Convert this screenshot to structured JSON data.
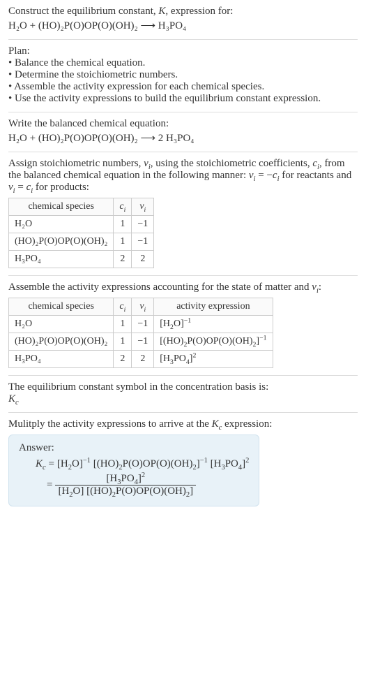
{
  "intro": {
    "heading": "Construct the equilibrium constant, K, expression for:",
    "reaction": "H₂O + (HO)₂P(O)OP(O)(OH)₂  ⟶  H₃PO₄"
  },
  "plan": {
    "title": "Plan:",
    "items": [
      "• Balance the chemical equation.",
      "• Determine the stoichiometric numbers.",
      "• Assemble the activity expression for each chemical species.",
      "• Use the activity expressions to build the equilibrium constant expression."
    ]
  },
  "balanced": {
    "heading": "Write the balanced chemical equation:",
    "reaction": "H₂O + (HO)₂P(O)OP(O)(OH)₂  ⟶  2 H₃PO₄"
  },
  "stoich": {
    "heading": "Assign stoichiometric numbers, νᵢ, using the stoichiometric coefficients, cᵢ, from the balanced chemical equation in the following manner: νᵢ = −cᵢ for reactants and νᵢ = cᵢ for products:",
    "headers": [
      "chemical species",
      "cᵢ",
      "νᵢ"
    ],
    "rows": [
      {
        "species": "H₂O",
        "c": "1",
        "v": "−1"
      },
      {
        "species": "(HO)₂P(O)OP(O)(OH)₂",
        "c": "1",
        "v": "−1"
      },
      {
        "species": "H₃PO₄",
        "c": "2",
        "v": "2"
      }
    ]
  },
  "activity": {
    "heading": "Assemble the activity expressions accounting for the state of matter and νᵢ:",
    "headers": [
      "chemical species",
      "cᵢ",
      "νᵢ",
      "activity expression"
    ],
    "rows": [
      {
        "species": "H₂O",
        "c": "1",
        "v": "−1",
        "act": "[H₂O]⁻¹"
      },
      {
        "species": "(HO)₂P(O)OP(O)(OH)₂",
        "c": "1",
        "v": "−1",
        "act": "[(HO)₂P(O)OP(O)(OH)₂]⁻¹"
      },
      {
        "species": "H₃PO₄",
        "c": "2",
        "v": "2",
        "act": "[H₃PO₄]²"
      }
    ]
  },
  "symbol": {
    "heading": "The equilibrium constant symbol in the concentration basis is:",
    "value": "K𝚌"
  },
  "multiply": {
    "heading": "Mulitply the activity expressions to arrive at the K𝚌 expression:"
  },
  "answer": {
    "label": "Answer:",
    "line1_lhs": "K𝚌 =",
    "line1_rhs": "[H₂O]⁻¹ [(HO)₂P(O)OP(O)(OH)₂]⁻¹ [H₃PO₄]²",
    "line2_eq": "=",
    "frac_num": "[H₃PO₄]²",
    "frac_den": "[H₂O] [(HO)₂P(O)OP(O)(OH)₂]"
  }
}
